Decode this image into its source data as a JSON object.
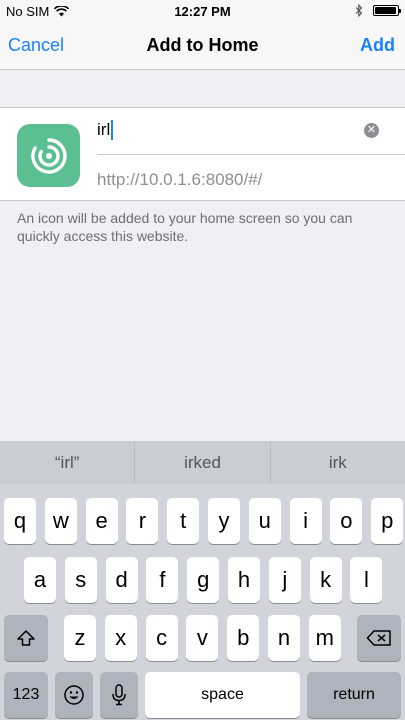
{
  "status_bar": {
    "carrier": "No SIM",
    "time": "12:27 PM",
    "battery_level": 0.95
  },
  "nav": {
    "cancel_label": "Cancel",
    "title": "Add to Home",
    "add_label": "Add"
  },
  "form": {
    "name_value": "irl",
    "url_value": "http://10.0.1.6:8080/#/"
  },
  "note": "An icon will be added to your home screen so you can quickly access this website.",
  "keyboard": {
    "suggestions": [
      "“irl”",
      "irked",
      "irk"
    ],
    "row1": [
      "q",
      "w",
      "e",
      "r",
      "t",
      "y",
      "u",
      "i",
      "o",
      "p"
    ],
    "row2": [
      "a",
      "s",
      "d",
      "f",
      "g",
      "h",
      "j",
      "k",
      "l"
    ],
    "row3": [
      "z",
      "x",
      "c",
      "v",
      "b",
      "n",
      "m"
    ],
    "numbers_label": "123",
    "space_label": "space",
    "return_label": "return"
  },
  "colors": {
    "accent": "#1a82fb",
    "app_icon_bg": "#5cbf91"
  }
}
